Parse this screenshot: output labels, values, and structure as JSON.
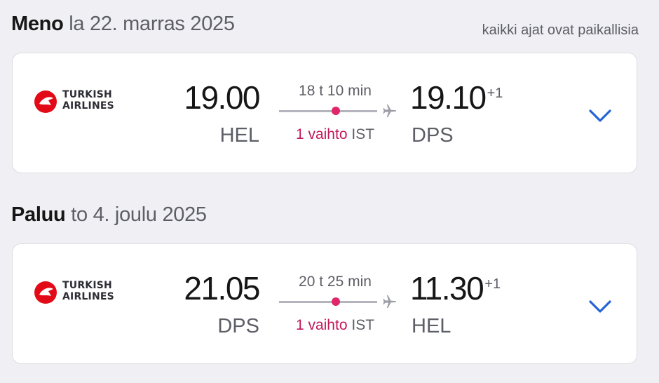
{
  "note": "kaikki ajat ovat paikallisia",
  "colors": {
    "background": "#f0f0f4",
    "card": "#ffffff",
    "stop_accent": "#e0266b",
    "chevron": "#2563d6",
    "airline_red": "#e30a17"
  },
  "icons": {
    "airline_logo": "turkish-airlines-logo",
    "plane": "plane-icon",
    "expand": "chevron-down-icon"
  },
  "outbound": {
    "label": "Meno",
    "date": "la 22. marras 2025",
    "airline_line1": "TURKISH",
    "airline_line2": "AIRLINES",
    "dep_time": "19.00",
    "dep_code": "HEL",
    "duration": "18 t 10 min",
    "stops": "1 vaihto",
    "stop_code": "IST",
    "arr_time": "19.10",
    "arr_offset": "+1",
    "arr_code": "DPS"
  },
  "inbound": {
    "label": "Paluu",
    "date": "to 4. joulu 2025",
    "airline_line1": "TURKISH",
    "airline_line2": "AIRLINES",
    "dep_time": "21.05",
    "dep_code": "DPS",
    "duration": "20 t 25 min",
    "stops": "1 vaihto",
    "stop_code": "IST",
    "arr_time": "11.30",
    "arr_offset": "+1",
    "arr_code": "HEL"
  }
}
